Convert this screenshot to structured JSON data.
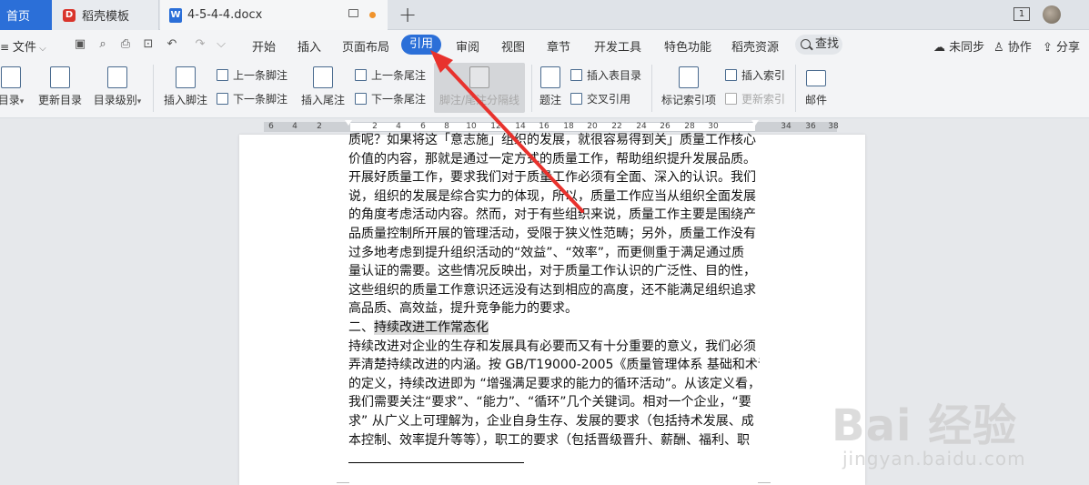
{
  "titlebar": {
    "tabs": [
      {
        "label": "首页"
      },
      {
        "label": "稻壳模板"
      },
      {
        "label": "4-5-4-4.docx"
      }
    ],
    "window_count": "1"
  },
  "menubar": {
    "file_label": "文件",
    "items": [
      "开始",
      "插入",
      "页面布局",
      "引用",
      "审阅",
      "视图",
      "章节",
      "开发工具",
      "特色功能",
      "稻壳资源"
    ],
    "active": "引用",
    "search_label": "查找",
    "right_actions": [
      "未同步",
      "协作",
      "分享"
    ]
  },
  "ribbon": {
    "toc": "目录",
    "update_toc": "更新目录",
    "toc_level": "目录级别",
    "insert_footnote": "插入脚注",
    "prev_footnote": "上一条脚注",
    "next_footnote": "下一条脚注",
    "insert_endnote": "插入尾注",
    "prev_endnote": "上一条尾注",
    "next_endnote": "下一条尾注",
    "separator": "脚注/尾注分隔线",
    "caption": "题注",
    "insert_table_of_figures": "插入表目录",
    "cross_ref": "交叉引用",
    "mark_index": "标记索引项",
    "insert_index": "插入索引",
    "update_index": "更新索引",
    "mail": "邮件"
  },
  "ruler": {
    "ticks": [
      "6",
      "4",
      "2",
      "2",
      "4",
      "6",
      "8",
      "10",
      "12",
      "14",
      "16",
      "18",
      "20",
      "22",
      "24",
      "26",
      "28",
      "30",
      "34",
      "36",
      "38"
    ]
  },
  "document": {
    "lines": [
      "质呢？如果将这「意志施」组织的发展，就很容易得到关」质量工作核心",
      "价值的内容，那就是通过一定方式的质量工作，帮助组织提升发展品质。",
      "开展好质量工作，要求我们对于质量工作必须有全面、深入的认识。我们",
      "说，组织的发展是综合实力的体现，所以，质量工作应当从组织全面发展",
      "的角度考虑活动内容。然而，对于有些组织来说，质量工作主要是围绕产",
      "品质量控制所开展的管理活动，受限于狭义性范畴；另外，质量工作没有",
      "过多地考虑到提升组织活动的“效益”、“效率”，而更侧重于满足通过质",
      "量认证的需要。这些情况反映出，对于质量工作认识的广泛性、目的性，",
      "这些组织的质量工作意识还远没有达到相应的高度，还不能满足组织追求",
      "高品质、高效益，提升竞争能力的要求。"
    ],
    "heading_prefix": "二、",
    "heading_highlight": "持续改进工作常态化",
    "lines2": [
      "持续改进对企业的生存和发展具有必要而又有十分重要的意义，我们必须",
      "弄清楚持续改进的内涵。按 GB/T19000-2005《质量管理体系  基础和术语》",
      "的定义，持续改进即为 “增强满足要求的能力的循环活动”。从该定义看，",
      "我们需要关注“要求”、“能力”、“循环”几个关键词。相对一个企业，“要",
      "求” 从广义上可理解为，企业自身生存、发展的要求（包括持术发展、成",
      "本控制、效率提升等等），职工的要求（包括晋级晋升、薪酬、福利、职"
    ]
  },
  "watermark": {
    "main": "Bai  经验",
    "sub": "jingyan.baidu.com"
  },
  "annotation": {
    "color": "#e8322d"
  }
}
